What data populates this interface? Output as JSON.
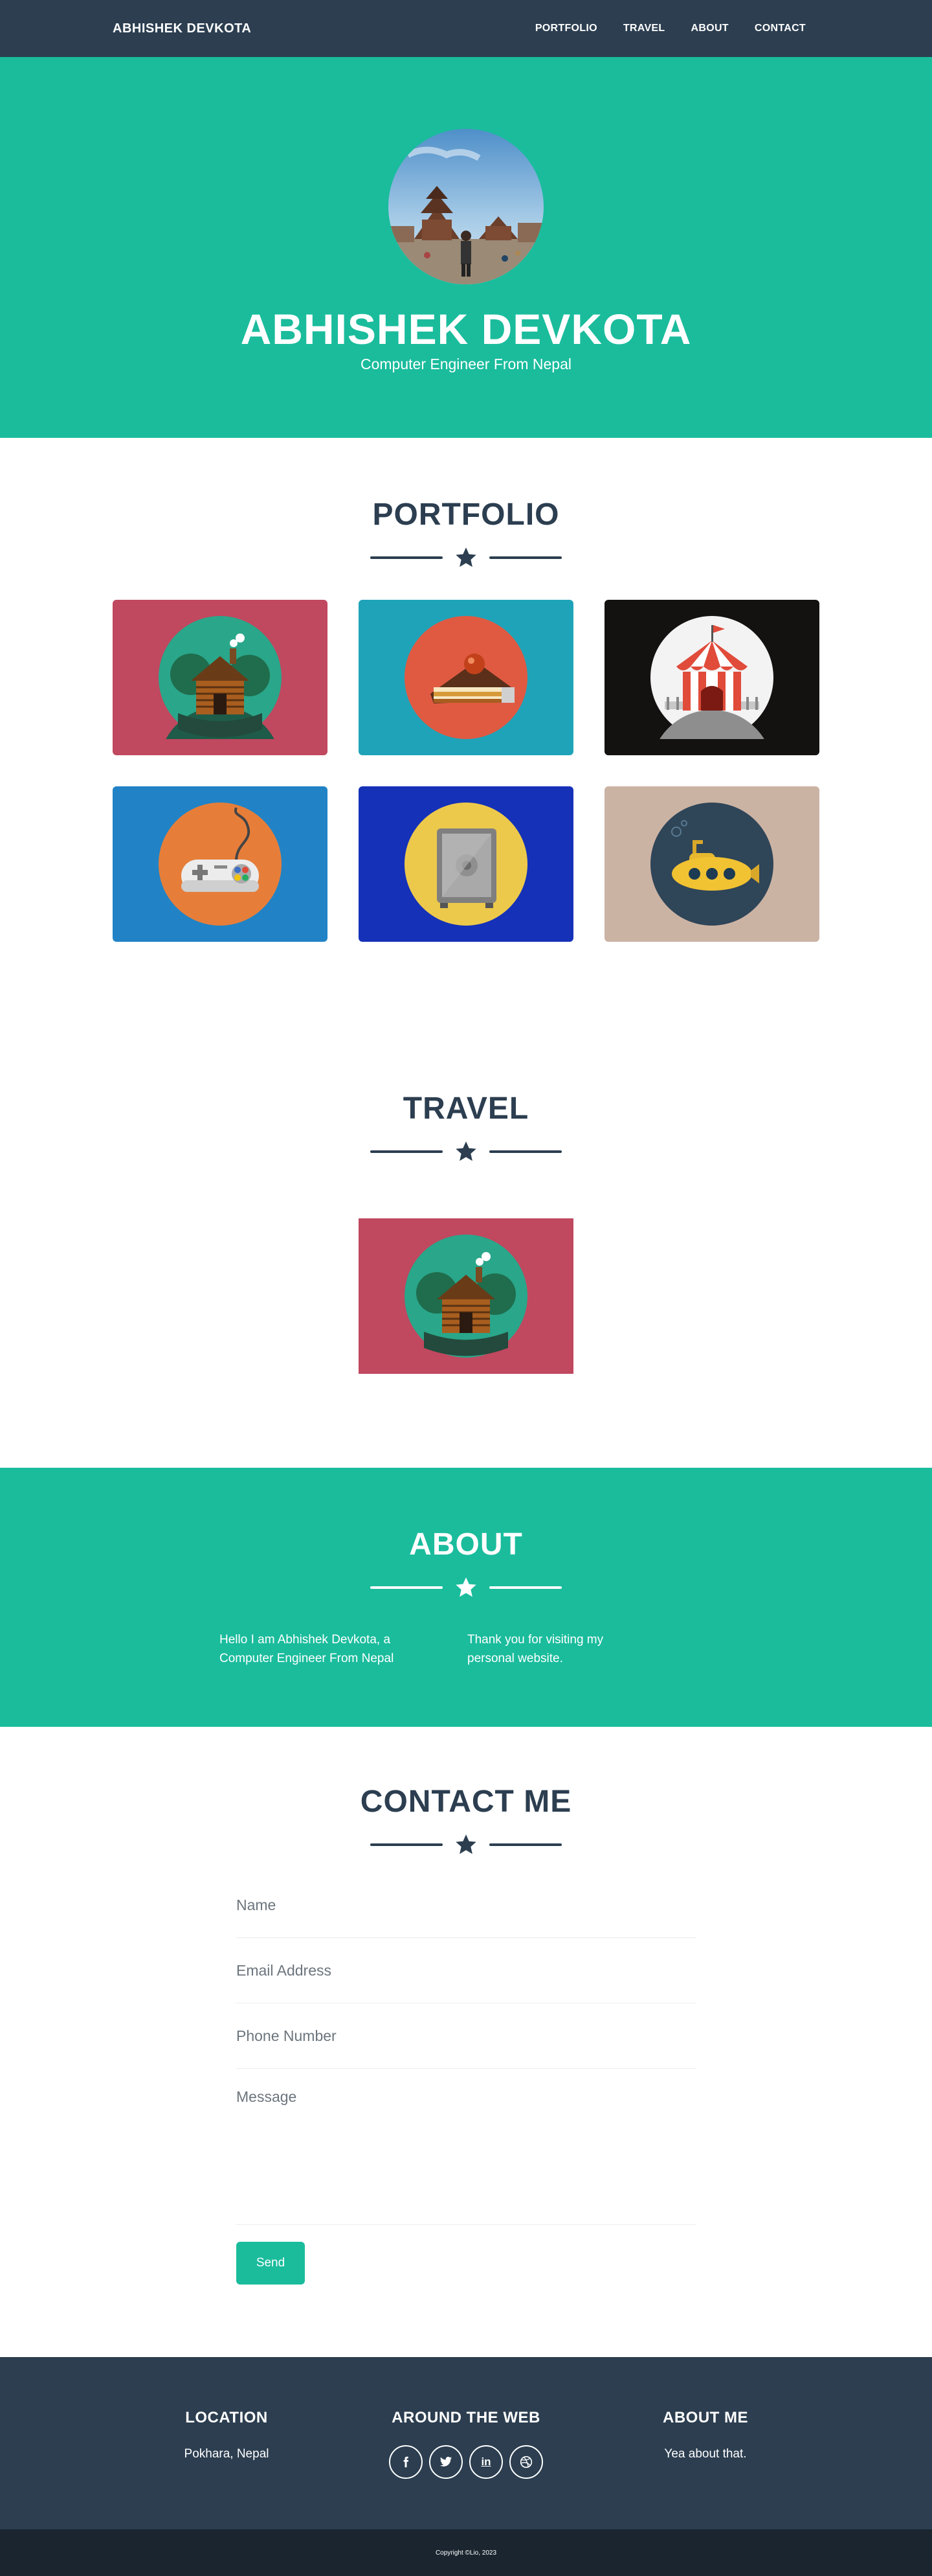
{
  "navbar": {
    "brand": "ABHISHEK DEVKOTA",
    "links": [
      "PORTFOLIO",
      "TRAVEL",
      "ABOUT",
      "CONTACT"
    ]
  },
  "masthead": {
    "name": "ABHISHEK DEVKOTA",
    "subtitle": "Computer Engineer From Nepal"
  },
  "portfolio": {
    "title": "PORTFOLIO",
    "items": [
      {
        "icon": "cabin-icon",
        "bg": "#c0485f"
      },
      {
        "icon": "cake-icon",
        "bg": "#1fa3b8"
      },
      {
        "icon": "circus-tent-icon",
        "bg": "#141111"
      },
      {
        "icon": "game-controller-icon",
        "bg": "#2183c6"
      },
      {
        "icon": "safe-icon",
        "bg": "#1531b8"
      },
      {
        "icon": "submarine-icon",
        "bg": "#cbb3a4"
      }
    ]
  },
  "travel": {
    "title": "TRAVEL",
    "items": [
      {
        "icon": "cabin-icon",
        "bg": "#c0485f"
      }
    ]
  },
  "about": {
    "title": "ABOUT",
    "col1": "Hello I am Abhishek Devkota, a Computer Engineer From Nepal",
    "col2": "Thank you for visiting my personal website."
  },
  "contact": {
    "title": "CONTACT ME",
    "name_placeholder": "Name",
    "email_placeholder": "Email Address",
    "phone_placeholder": "Phone Number",
    "message_placeholder": "Message",
    "send_label": "Send"
  },
  "footer": {
    "location_title": "LOCATION",
    "location_text": "Pokhara, Nepal",
    "web_title": "AROUND THE WEB",
    "socials": [
      "f",
      "t",
      "in",
      "dribbble-icon"
    ],
    "about_title": "ABOUT ME",
    "about_text": "Yea about that.",
    "copyright": "Copyright ©Lio, 2023"
  },
  "colors": {
    "primary": "#1abc9c",
    "dark": "#2c3e50",
    "darker": "#1a252f"
  }
}
